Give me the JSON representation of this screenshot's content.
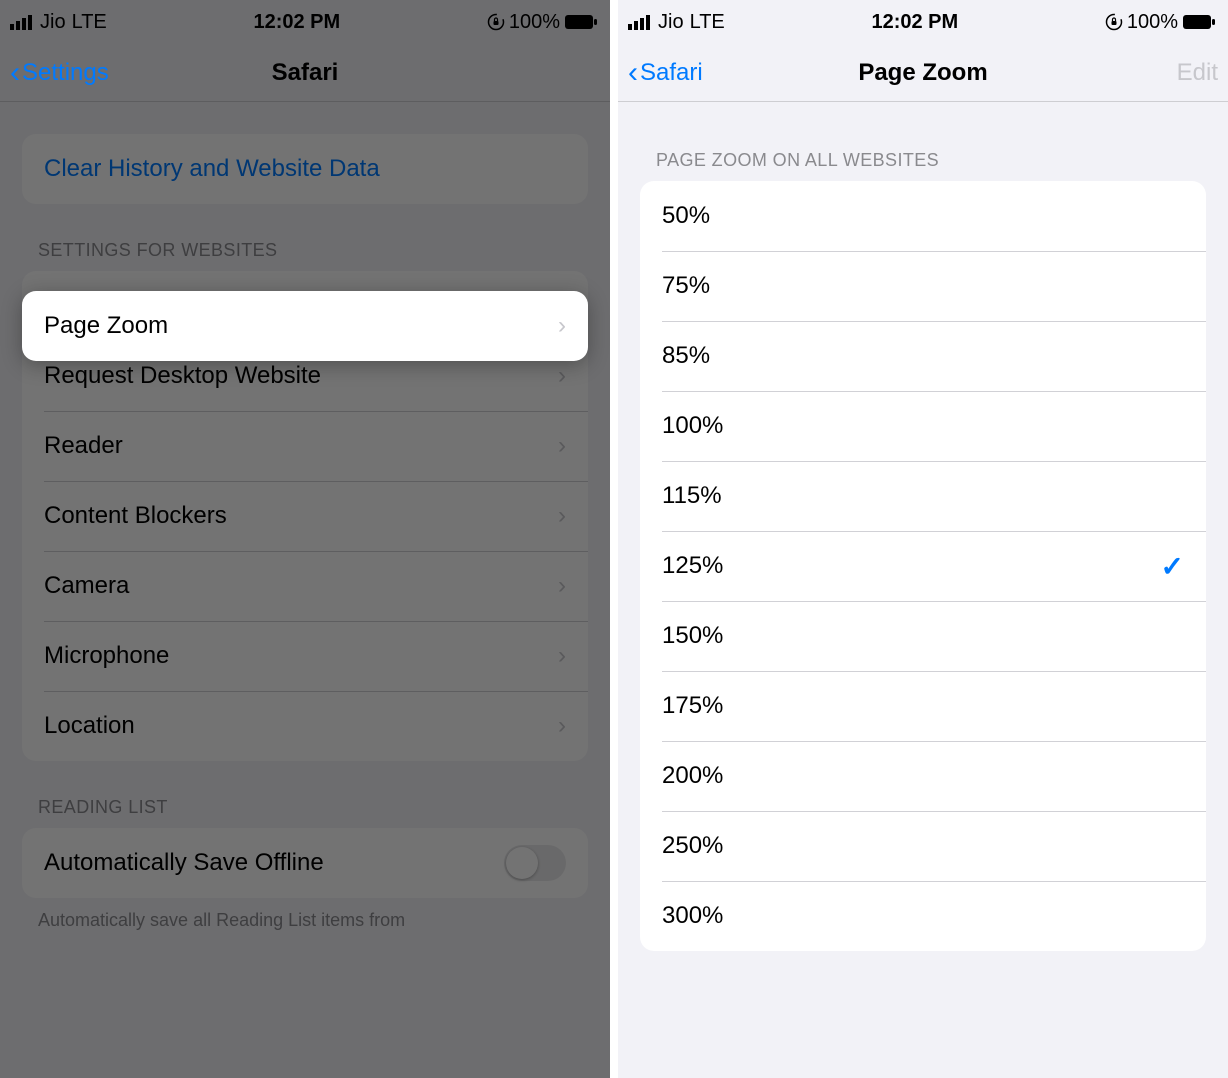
{
  "status_bar": {
    "carrier": "Jio",
    "network": "LTE",
    "time": "12:02 PM",
    "battery_pct": "100%"
  },
  "left": {
    "nav_back": "Settings",
    "nav_title": "Safari",
    "clear_history_label": "Clear History and Website Data",
    "section_websites_header": "SETTINGS FOR WEBSITES",
    "rows": {
      "page_zoom": "Page Zoom",
      "request_desktop": "Request Desktop Website",
      "reader": "Reader",
      "content_blockers": "Content Blockers",
      "camera": "Camera",
      "microphone": "Microphone",
      "location": "Location"
    },
    "section_reading_list_header": "READING LIST",
    "auto_save_offline_label": "Automatically Save Offline",
    "auto_save_offline_on": false,
    "footer_text": "Automatically save all Reading List items from"
  },
  "right": {
    "nav_back": "Safari",
    "nav_title": "Page Zoom",
    "nav_edit": "Edit",
    "section_header": "PAGE ZOOM ON ALL WEBSITES",
    "options": [
      "50%",
      "75%",
      "85%",
      "100%",
      "115%",
      "125%",
      "150%",
      "175%",
      "200%",
      "250%",
      "300%"
    ],
    "selected": "125%"
  }
}
